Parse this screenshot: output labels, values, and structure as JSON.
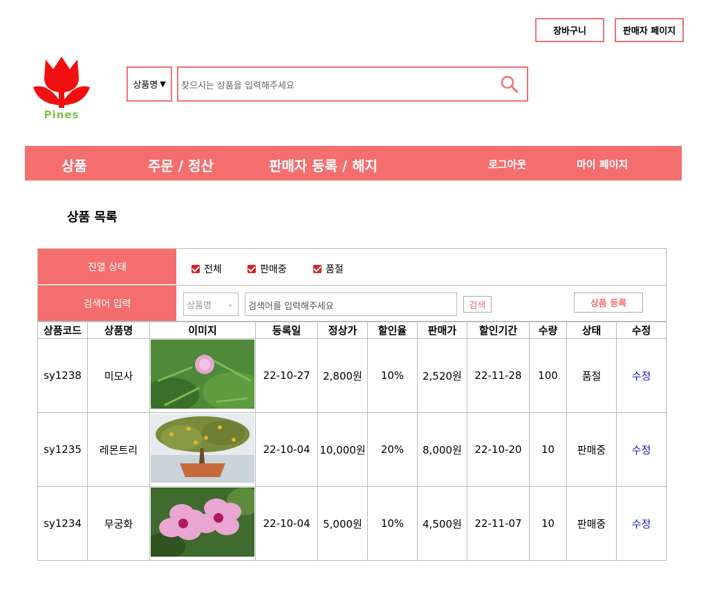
{
  "header": {
    "cart_label": "장바구니",
    "seller_page_label": "판매자 페이지",
    "logo_text": "Pines"
  },
  "search": {
    "category_selected": "상품명",
    "placeholder": "찾으시는 상품을 입력해주세요"
  },
  "nav": {
    "items": [
      "상품",
      "주문 / 정산",
      "판매자 등록 / 해지"
    ],
    "logout": "로그아웃",
    "mypage": "마이 페이지"
  },
  "page_title": "상품 목록",
  "filter": {
    "display_label": "진열 상태",
    "options": [
      "전체",
      "판매중",
      "품절"
    ],
    "search_label": "검색어 입력",
    "search_select": "상품명",
    "search_placeholder": "검색어를 입력해주세요",
    "search_button": "검색",
    "register_button": "상품 등록"
  },
  "table": {
    "headers": [
      "상품코드",
      "상품명",
      "이미지",
      "등록일",
      "정상가",
      "할인율",
      "판매가",
      "할인기간",
      "수량",
      "상태",
      "수정"
    ],
    "rows": [
      {
        "code": "sy1238",
        "name": "미모사",
        "date": "22-10-27",
        "price": "2,800원",
        "rate": "10%",
        "sale": "2,520원",
        "period": "22-11-28",
        "qty": "100",
        "status": "품절",
        "edit": "수정"
      },
      {
        "code": "sy1235",
        "name": "레몬트리",
        "date": "22-10-04",
        "price": "10,000원",
        "rate": "20%",
        "sale": "8,000원",
        "period": "22-10-20",
        "qty": "10",
        "status": "판매중",
        "edit": "수정"
      },
      {
        "code": "sy1234",
        "name": "무궁화",
        "date": "22-10-04",
        "price": "5,000원",
        "rate": "10%",
        "sale": "4,500원",
        "period": "22-11-07",
        "qty": "10",
        "status": "판매중",
        "edit": "수정"
      }
    ]
  },
  "colors": {
    "accent": "#f56e6e",
    "logo_green": "#7dc24a",
    "edit_link": "#1a1acc"
  },
  "icons": [
    "tulip-logo",
    "search-icon",
    "chevron-down-icon",
    "checkbox-checked"
  ]
}
